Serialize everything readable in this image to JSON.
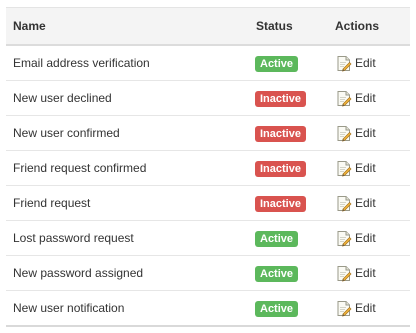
{
  "table": {
    "headers": {
      "name": "Name",
      "status": "Status",
      "actions": "Actions"
    },
    "rows": [
      {
        "name": "Email address verification",
        "status": "Active",
        "action": "Edit"
      },
      {
        "name": "New user declined",
        "status": "Inactive",
        "action": "Edit"
      },
      {
        "name": "New user confirmed",
        "status": "Inactive",
        "action": "Edit"
      },
      {
        "name": "Friend request confirmed",
        "status": "Inactive",
        "action": "Edit"
      },
      {
        "name": "Friend request",
        "status": "Inactive",
        "action": "Edit"
      },
      {
        "name": "Lost password request",
        "status": "Active",
        "action": "Edit"
      },
      {
        "name": "New password assigned",
        "status": "Active",
        "action": "Edit"
      },
      {
        "name": "New user notification",
        "status": "Active",
        "action": "Edit"
      }
    ]
  },
  "colors": {
    "active": "#5cb85c",
    "inactive": "#d9534f",
    "header_bg": "#f4f4f4"
  },
  "icons": {
    "edit": "edit-document-icon"
  }
}
